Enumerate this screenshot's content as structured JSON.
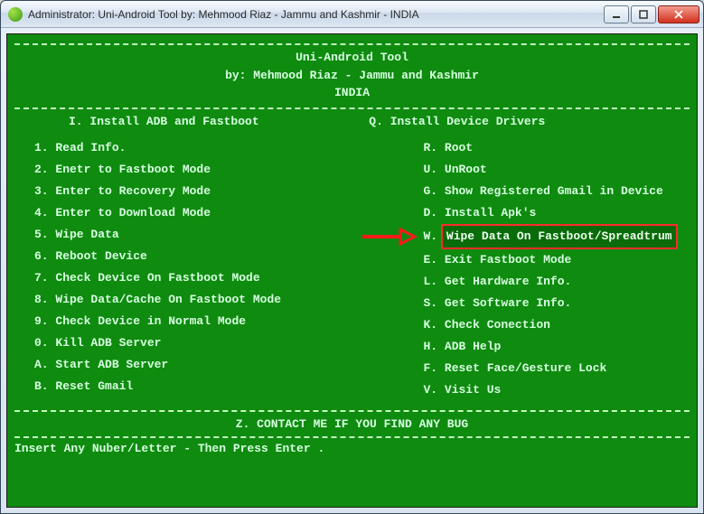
{
  "window": {
    "title": "Administrator:  Uni-Android Tool by: Mehmood Riaz - Jammu and Kashmir - INDIA"
  },
  "header": {
    "line1": "Uni-Android Tool",
    "line2": "by: Mehmood Riaz - Jammu and Kashmir",
    "line3": "INDIA"
  },
  "sections": {
    "left_head": "I. Install ADB and Fastboot",
    "right_head": "Q. Install Device Drivers"
  },
  "left_items": [
    {
      "key": "1",
      "label": "Read Info."
    },
    {
      "key": "2",
      "label": "Enetr to Fastboot Mode"
    },
    {
      "key": "3",
      "label": "Enter to Recovery Mode"
    },
    {
      "key": "4",
      "label": "Enter to Download Mode"
    },
    {
      "key": "5",
      "label": "Wipe Data"
    },
    {
      "key": "6",
      "label": "Reboot Device"
    },
    {
      "key": "7",
      "label": "Check Device On Fastboot Mode"
    },
    {
      "key": "8",
      "label": "Wipe Data/Cache On Fastboot Mode"
    },
    {
      "key": "9",
      "label": "Check Device in Normal Mode"
    },
    {
      "key": "0",
      "label": "Kill ADB Server"
    },
    {
      "key": "A",
      "label": "Start ADB Server"
    },
    {
      "key": "B",
      "label": "Reset Gmail"
    }
  ],
  "right_items": [
    {
      "key": "R",
      "label": "Root"
    },
    {
      "key": "U",
      "label": "UnRoot"
    },
    {
      "key": "G",
      "label": "Show Registered Gmail in Device"
    },
    {
      "key": "D",
      "label": "Install Apk's"
    },
    {
      "key": "W",
      "label": "Wipe Data On Fastboot/Spreadtrum",
      "highlight": true
    },
    {
      "key": "E",
      "label": "Exit Fastboot Mode"
    },
    {
      "key": "L",
      "label": "Get Hardware Info."
    },
    {
      "key": "S",
      "label": "Get Software Info."
    },
    {
      "key": "K",
      "label": "Check Conection"
    },
    {
      "key": "H",
      "label": "ADB Help"
    },
    {
      "key": "F",
      "label": "Reset Face/Gesture Lock"
    },
    {
      "key": "V",
      "label": "Visit Us"
    }
  ],
  "footer": {
    "contact": "Z. CONTACT ME IF YOU FIND ANY BUG",
    "prompt": "Insert Any Nuber/Letter - Then Press Enter  ."
  },
  "arrow_color": "#ff1a1a"
}
